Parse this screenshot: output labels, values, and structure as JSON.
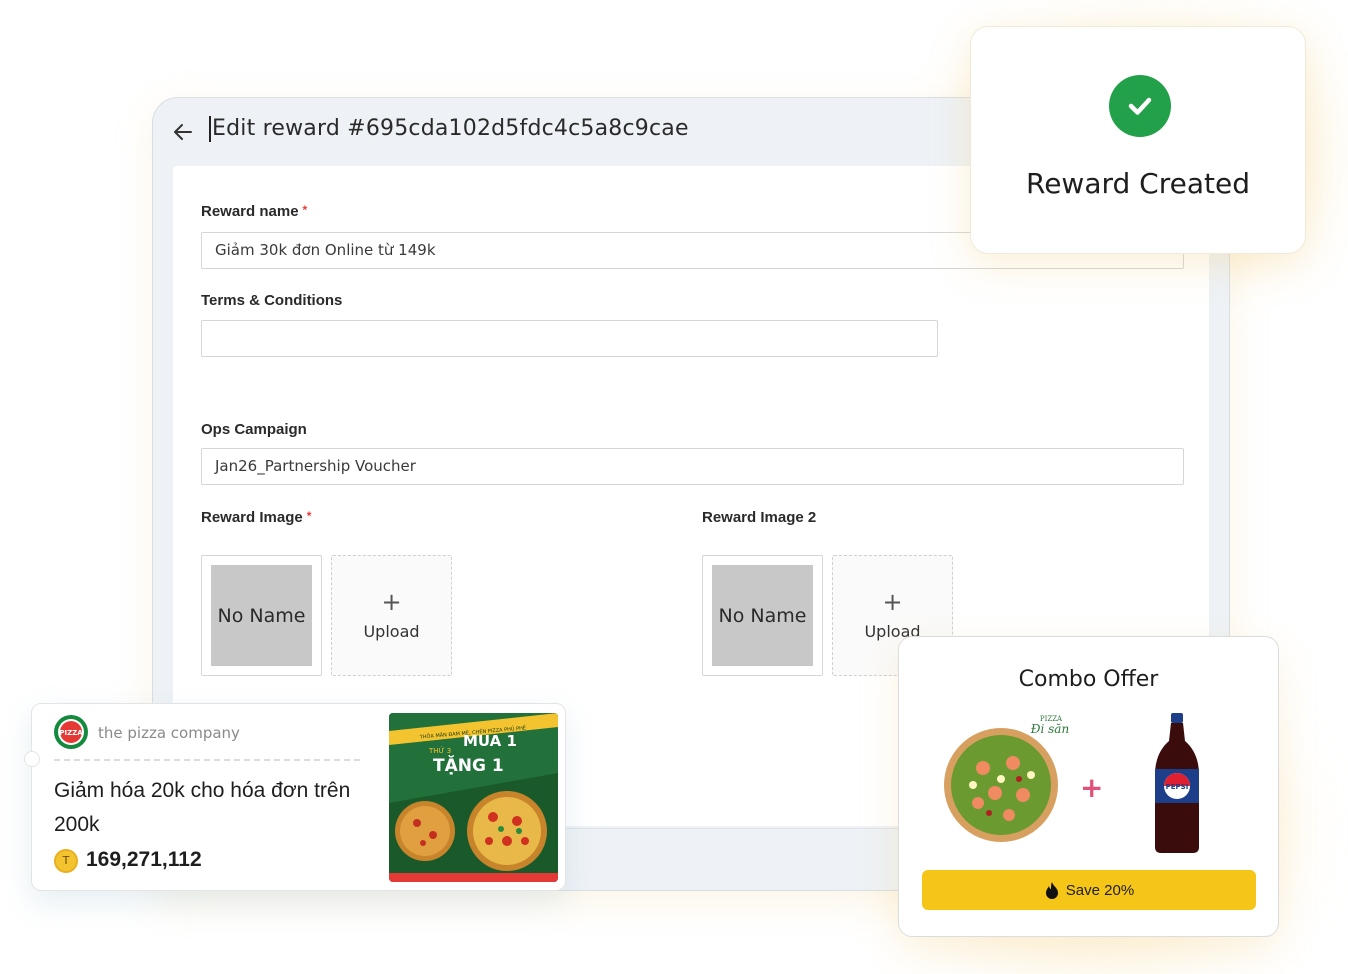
{
  "edit_panel": {
    "title": "Edit reward #695cda102d5fdc4c5a8c9cae",
    "reward_name": {
      "label": "Reward name",
      "required_mark": "*",
      "value": "Giảm 30k đơn Online từ 149k"
    },
    "terms": {
      "label": "Terms & Conditions",
      "value": ""
    },
    "ops_campaign": {
      "label": "Ops Campaign",
      "value": "Jan26_Partnership Voucher"
    },
    "reward_image": {
      "label": "Reward Image",
      "required_mark": "*",
      "thumb_text": "No Name",
      "upload_label": "Upload",
      "upload_icon": "+"
    },
    "reward_image_2": {
      "label": "Reward Image 2",
      "thumb_text": "No Name",
      "upload_label": "Upload",
      "upload_icon": "+"
    }
  },
  "toast": {
    "text": "Reward Created",
    "icon": "check-icon",
    "color": "#22a04a"
  },
  "voucher": {
    "brand": "the pizza company",
    "logo_text": "PIZZA",
    "title": "Giảm hóa 20k cho hóa đơn trên 200k",
    "coin_symbol": "T",
    "points": "169,271,112",
    "promo_text_line1": "MUA 1",
    "promo_text_line2": "TẶNG 1",
    "promo_top_text": "THỎA MÃN ĐAM MÊ, CHÉN PIZZA PHỦ PHÊ",
    "promo_day": "THỨ 3"
  },
  "combo": {
    "title": "Combo Offer",
    "pizza_tag": "Đi săn",
    "pizza_brand": "PIZZA",
    "bottle_label": "PEPSI",
    "save_label": "Save 20%",
    "accent": "#f5c518"
  }
}
